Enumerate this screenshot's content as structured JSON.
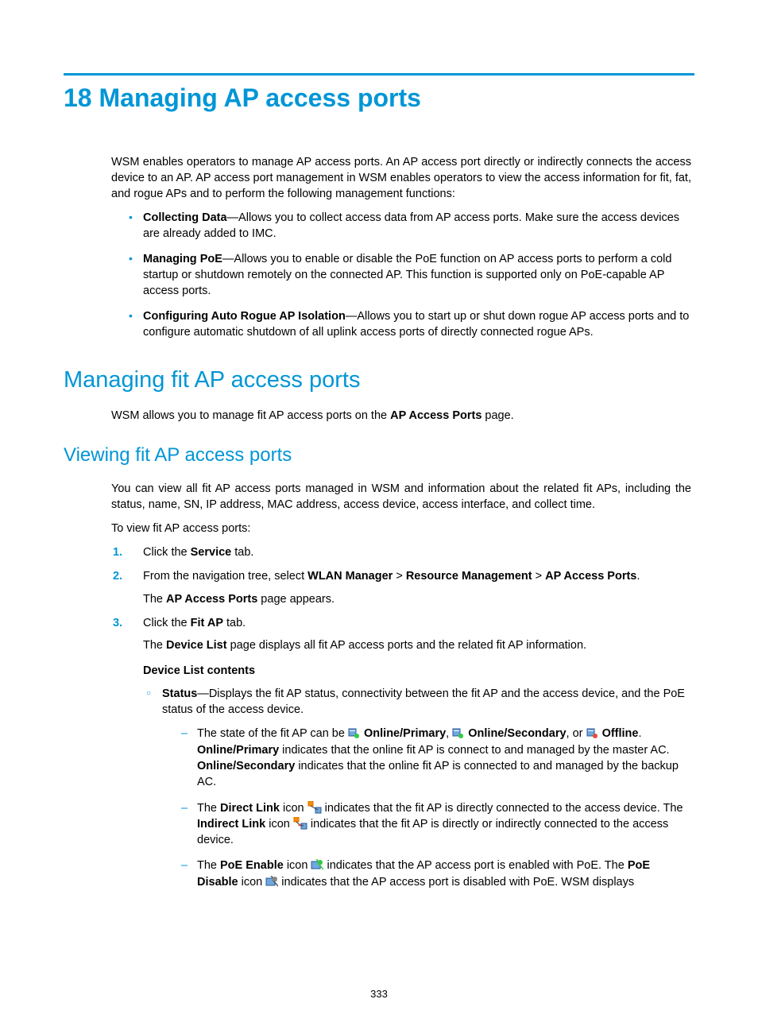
{
  "h1": "18 Managing AP access ports",
  "intro": "WSM enables operators to manage AP access ports. An AP access port directly or indirectly connects the access device to an AP. AP access port management in WSM enables operators to view the access information for fit, fat, and rogue APs and to perform the following management functions:",
  "bullets": {
    "b1_bold": "Collecting Data",
    "b1_rest": "—Allows you to collect access data from AP access ports. Make sure the access devices are already added to IMC.",
    "b2_bold": "Managing PoE",
    "b2_rest": "—Allows you to enable or disable the PoE function on AP access ports to perform a cold startup or shutdown remotely on the connected AP. This function is supported only on PoE-capable AP access ports.",
    "b3_bold": "Configuring Auto Rogue AP Isolation",
    "b3_rest": "—Allows you to start up or shut down rogue AP access ports and to configure automatic shutdown of all uplink access ports of directly connected rogue APs."
  },
  "h2": "Managing fit AP access ports",
  "h2_p_pre": "WSM allows you to manage fit AP access ports on the ",
  "h2_p_bold": "AP Access Ports",
  "h2_p_post": " page.",
  "h3": "Viewing fit AP access ports",
  "h3_p1": "You can view all fit AP access ports managed in WSM and information about the related fit APs, including the status, name, SN, IP address, MAC address, access device, access interface, and collect time.",
  "h3_p2": "To view fit AP access ports:",
  "steps": {
    "s1_pre": "Click the ",
    "s1_b": "Service",
    "s1_post": " tab.",
    "s2_pre": "From the navigation tree, select ",
    "s2_b1": "WLAN Manager",
    "s2_sep": " > ",
    "s2_b2": "Resource Management",
    "s2_b3": "AP Access Ports",
    "s2_post": ".",
    "s2_body_pre": "The ",
    "s2_body_b": "AP Access Ports",
    "s2_body_post": " page appears.",
    "s3_pre": "Click the ",
    "s3_b": "Fit AP",
    "s3_post": " tab.",
    "s3_body_pre": "The ",
    "s3_body_b": "Device List",
    "s3_body_post": " page displays all fit AP access ports and the related fit AP information.",
    "s3_subheading": "Device List contents",
    "status_b": "Status",
    "status_rest": "—Displays the fit AP status, connectivity between the fit AP and the access device, and the PoE status of the access device.",
    "dash1_pre": "The state of the fit AP can be ",
    "dash1_b1": "Online/Primary",
    "dash1_mid1": ", ",
    "dash1_b2": "Online/Secondary",
    "dash1_mid2": ", or ",
    "dash1_b3": "Offline",
    "dash1_post1": ". ",
    "dash1_b4": "Online/Primary",
    "dash1_post2": " indicates that the online fit AP is connect to and managed by the master AC. ",
    "dash1_b5": "Online/Secondary",
    "dash1_post3": " indicates that the online fit AP is connected to and managed by the backup AC.",
    "dash2_pre": "The ",
    "dash2_b1": "Direct Link",
    "dash2_mid1": " icon ",
    "dash2_post1": " indicates that the fit AP is directly connected to the access device. The ",
    "dash2_b2": "Indirect Link",
    "dash2_mid2": " icon ",
    "dash2_post2": " indicates that the fit AP is directly or indirectly connected to the access device.",
    "dash3_pre": "The ",
    "dash3_b1": "PoE Enable",
    "dash3_mid1": " icon ",
    "dash3_post1": " indicates that the AP access port is enabled with PoE. The ",
    "dash3_b2": "PoE Disable",
    "dash3_mid2": " icon ",
    "dash3_post2": " indicates that the AP access port is disabled with PoE. WSM displays"
  },
  "pagenum": "333"
}
